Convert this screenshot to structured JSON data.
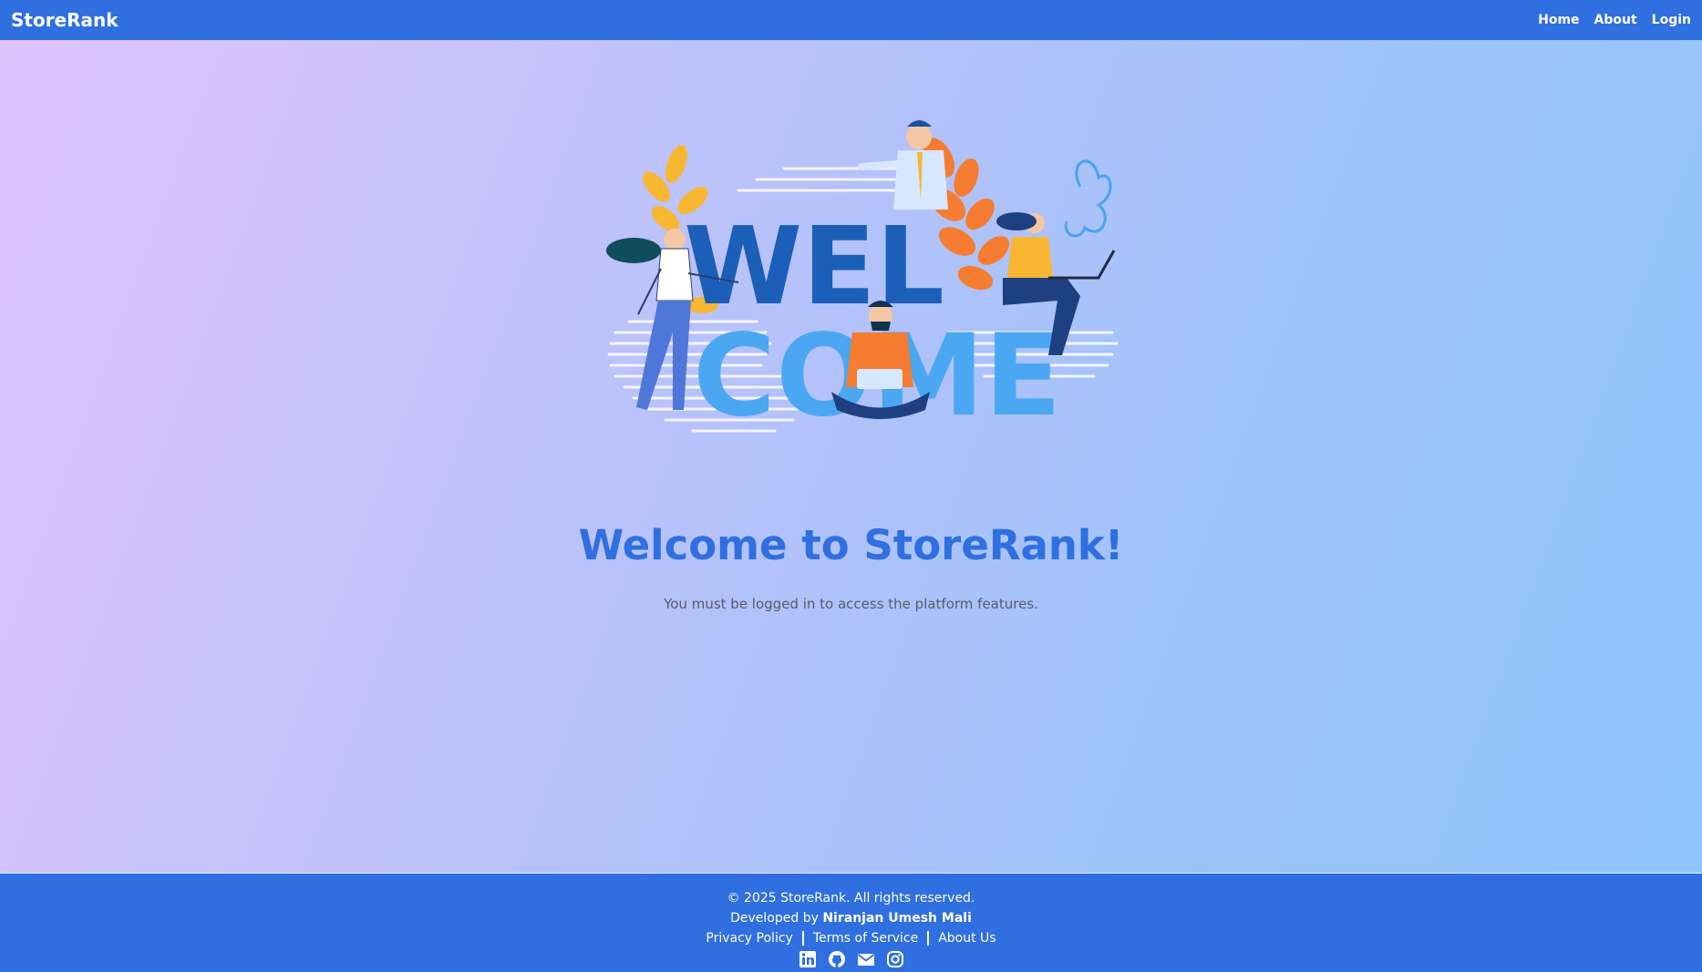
{
  "navbar": {
    "brand": "StoreRank",
    "links": [
      {
        "label": "Home"
      },
      {
        "label": "About"
      },
      {
        "label": "Login"
      }
    ]
  },
  "hero": {
    "illustration_text_line1": "WEL",
    "illustration_text_line2": "COME"
  },
  "main": {
    "title": "Welcome to StoreRank!",
    "subtitle": "You must be logged in to access the platform features."
  },
  "footer": {
    "copyright": "© 2025 StoreRank. All rights reserved.",
    "developed_prefix": "Developed by",
    "developer": "Niranjan Umesh Mali",
    "links": [
      {
        "label": "Privacy Policy"
      },
      {
        "label": "Terms of Service"
      },
      {
        "label": "About Us"
      }
    ],
    "socials": [
      {
        "icon": "linkedin-icon"
      },
      {
        "icon": "github-icon"
      },
      {
        "icon": "email-icon"
      },
      {
        "icon": "instagram-icon"
      }
    ]
  },
  "colors": {
    "primary": "#2f6fe0",
    "gradient_start": "#e0c4fc",
    "gradient_end": "#8ec5fc",
    "subtitle_text": "#555c66"
  }
}
